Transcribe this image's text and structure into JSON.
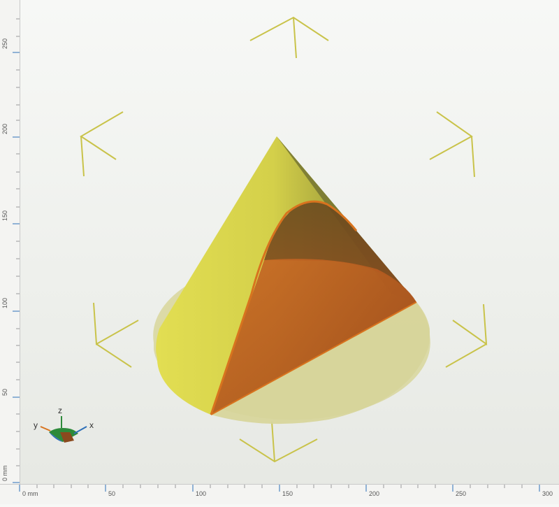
{
  "rulers": {
    "left_labels": [
      "250",
      "200",
      "150",
      "100",
      "50",
      "0 mm"
    ],
    "bottom_labels": [
      "0 mm",
      "50",
      "100",
      "150",
      "200",
      "250",
      "300"
    ]
  },
  "axis_gizmo": {
    "x": "x",
    "y": "y",
    "z": "z"
  },
  "colors": {
    "bracket": "#c9c34a",
    "cone": "#dcd84a",
    "cut_face": "#c9641f",
    "cut_edge": "#d8731e",
    "base": "#d9d7a0"
  }
}
